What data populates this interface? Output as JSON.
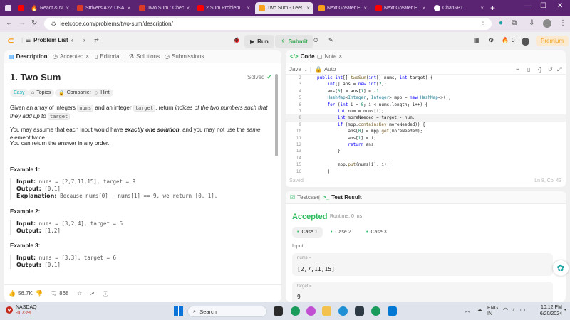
{
  "browser": {
    "tabs": [
      {
        "label": "React & Ni",
        "favicon_color": "#ff0000"
      },
      {
        "label": "Strivers A2Z DSA",
        "favicon_color": "#d93b27"
      },
      {
        "label": "Two Sum : Chec",
        "favicon_color": "#d93b27"
      },
      {
        "label": "2 Sum Problem",
        "favicon_color": "#ff0000"
      },
      {
        "label": "Two Sum - Leet",
        "favicon_color": "#f89f1b",
        "active": true
      },
      {
        "label": "Next Greater El",
        "favicon_color": "#f89f1b"
      },
      {
        "label": "Next Greater El",
        "favicon_color": "#ff0000"
      },
      {
        "label": "ChatGPT",
        "favicon_color": "#ffffff"
      }
    ],
    "url": "leetcode.com/problems/two-sum/description/"
  },
  "lc_top": {
    "problem_list": "Problem List",
    "run": "Run",
    "submit": "Submit",
    "streak": "0",
    "premium": "Premium"
  },
  "left_tabs": {
    "description": "Description",
    "accepted": "Accepted",
    "editorial": "Editorial",
    "solutions": "Solutions",
    "submissions": "Submissions"
  },
  "problem": {
    "title": "1. Two Sum",
    "status": "Solved",
    "tags": {
      "easy": "Easy",
      "topics": "Topics",
      "companies": "Companies",
      "hint": "Hint"
    },
    "p1_a": "Given an array of integers",
    "p1_code1": "nums",
    "p1_b": "and an integer",
    "p1_code2": "target",
    "p1_c": ", return",
    "p1_em": "indices of the two numbers such that they add up to",
    "p1_code3": "target",
    "p1_end": ".",
    "p2_a": "You may assume that each input would have",
    "p2_strong": "exactly one solution",
    "p2_b": ", and you may not use the",
    "p2_em": "same",
    "p2_c": "element twice.",
    "p3": "You can return the answer in any order.",
    "examples": [
      {
        "title": "Example 1:",
        "input_label": "Input:",
        "input": "nums = [2,7,11,15], target = 9",
        "output_label": "Output:",
        "output": "[0,1]",
        "explanation_label": "Explanation:",
        "explanation": "Because nums[0] + nums[1] == 9, we return [0, 1]."
      },
      {
        "title": "Example 2:",
        "input_label": "Input:",
        "input": "nums = [3,2,4], target = 6",
        "output_label": "Output:",
        "output": "[1,2]"
      },
      {
        "title": "Example 3:",
        "input_label": "Input:",
        "input": "nums = [3,3], target = 6",
        "output_label": "Output:",
        "output": "[0,1]"
      }
    ],
    "likes": "56.7K",
    "comments": "868"
  },
  "code_panel": {
    "tab_code": "Code",
    "tab_note": "Note",
    "language": "Java",
    "auto": "Auto",
    "saved": "Saved",
    "cursor": "Ln 8, Col 43",
    "lines": [
      {
        "n": "2",
        "t": "public int[] twoSum(int[] nums, int target) {"
      },
      {
        "n": "3",
        "t": "    int[] ans = new int[2];"
      },
      {
        "n": "4",
        "t": "    ans[0] = ans[1] = -1;"
      },
      {
        "n": "5",
        "t": "    HashMap<Integer, Integer> mpp = new HashMap<>();"
      },
      {
        "n": "6",
        "t": "    for (int i = 0; i < nums.length; i++) {"
      },
      {
        "n": "7",
        "t": "        int num = nums[i];"
      },
      {
        "n": "8",
        "t": "        int moreNeeded = target - num;"
      },
      {
        "n": "9",
        "t": "        if (mpp.containsKey(moreNeeded)) {"
      },
      {
        "n": "10",
        "t": "            ans[0] = mpp.get(moreNeeded);"
      },
      {
        "n": "11",
        "t": "            ans[1] = i;"
      },
      {
        "n": "12",
        "t": "            return ans;"
      },
      {
        "n": "13",
        "t": "        }"
      },
      {
        "n": "14",
        "t": ""
      },
      {
        "n": "15",
        "t": "        mpp.put(nums[i], i);"
      },
      {
        "n": "16",
        "t": "    }"
      }
    ]
  },
  "test_panel": {
    "tab_testcase": "Testcase",
    "tab_result": "Test Result",
    "verdict": "Accepted",
    "runtime": "Runtime: 0 ms",
    "cases": [
      "Case 1",
      "Case 2",
      "Case 3"
    ],
    "input_label": "Input",
    "var1_name": "nums =",
    "var1_value": "[2,7,11,15]",
    "var2_name": "target =",
    "var2_value": "9"
  },
  "taskbar": {
    "stock_name": "NASDAQ",
    "stock_change": "-0.73%",
    "search": "Search",
    "lang": "ENG",
    "region": "IN",
    "time": "10:12 PM",
    "date": "6/20/2024"
  }
}
